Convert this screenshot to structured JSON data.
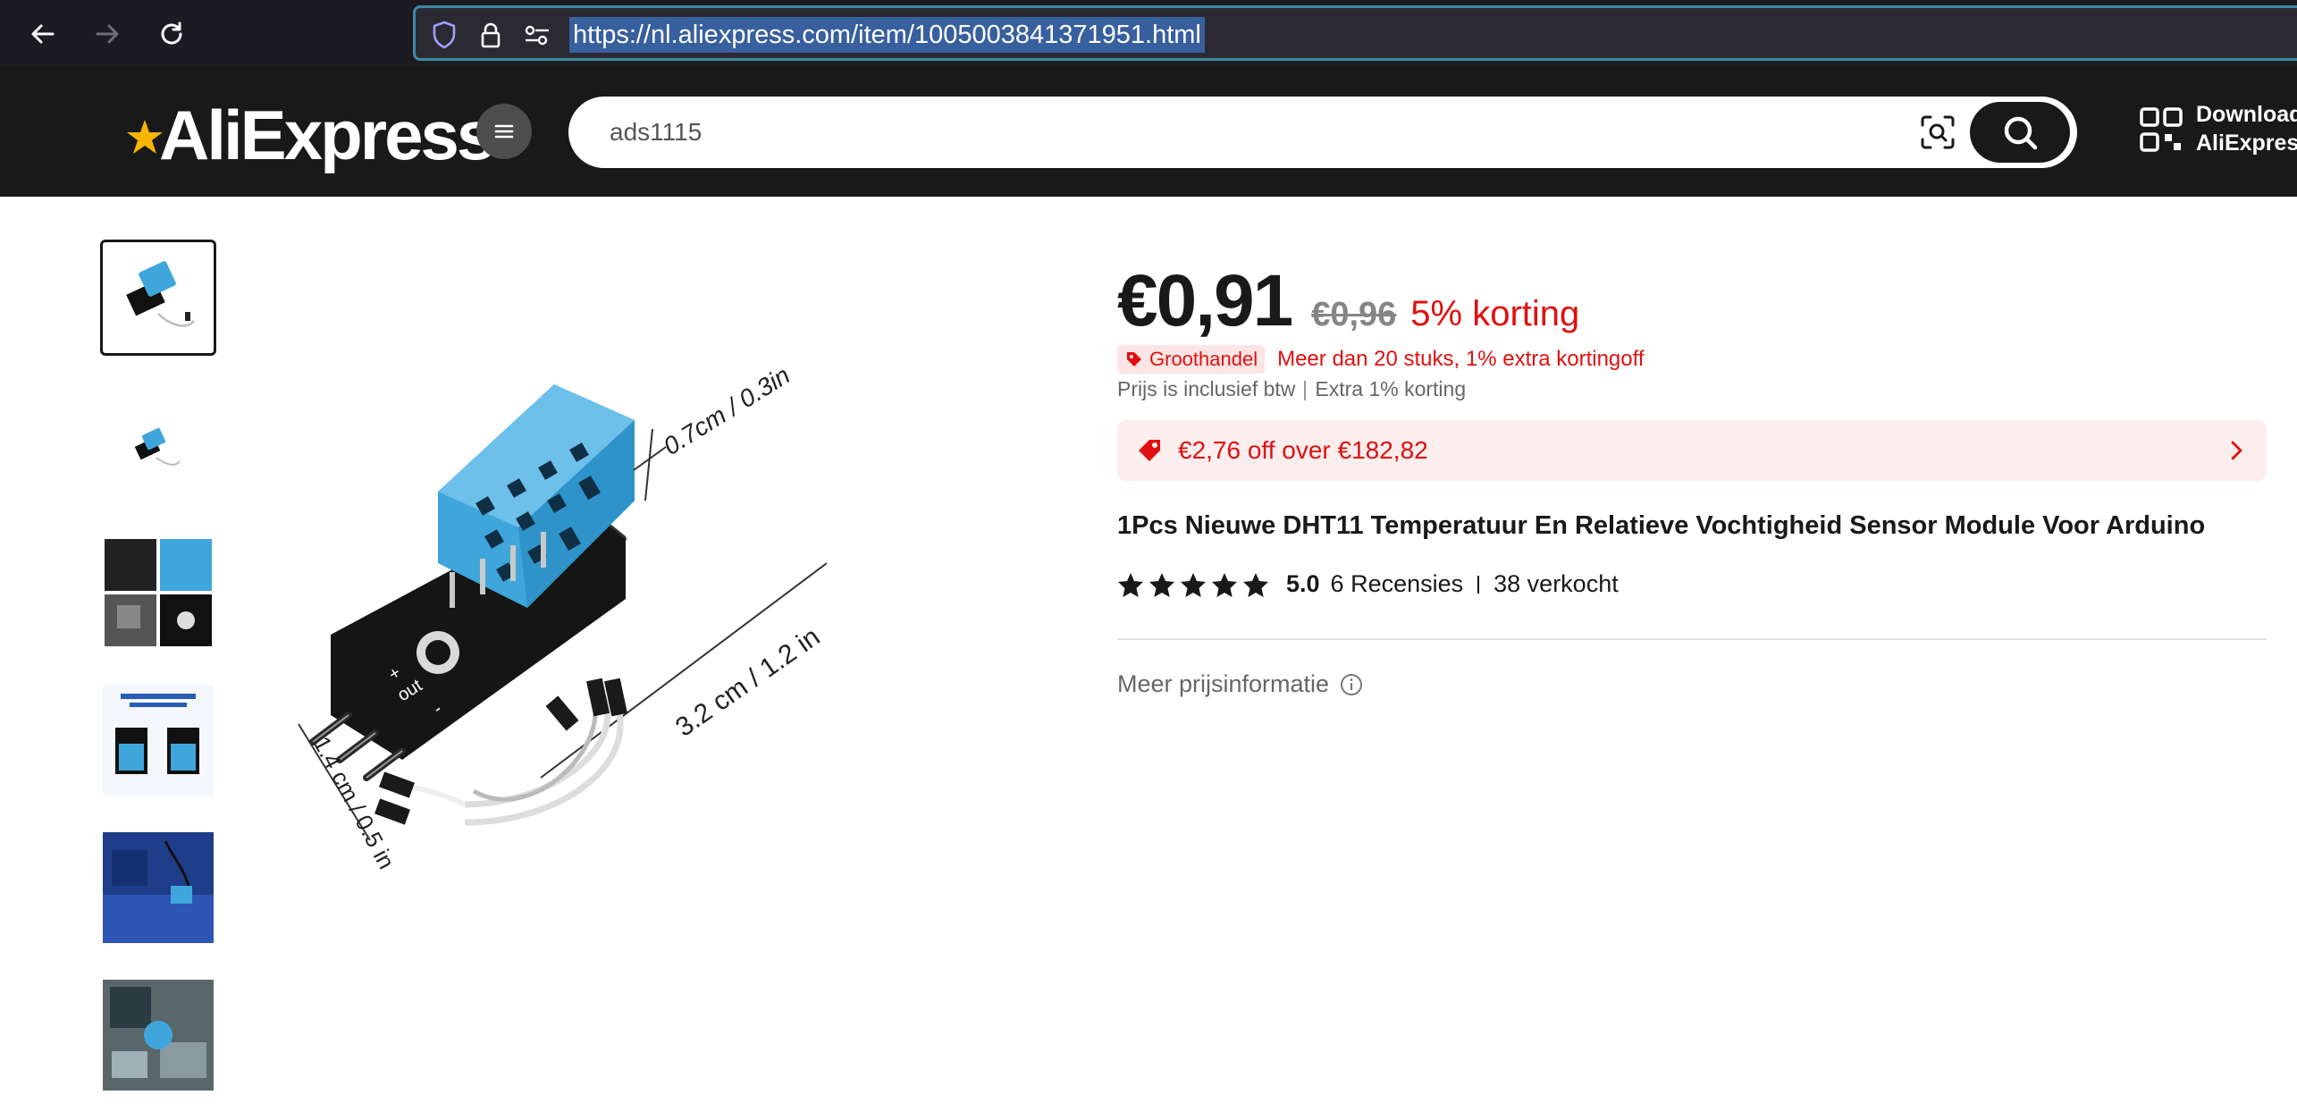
{
  "browser": {
    "url": "https://nl.aliexpress.com/item/1005003841371951.html"
  },
  "header": {
    "logo_text": "AliExpress",
    "search_value": "ads1115",
    "download_line1": "Download",
    "download_line2": "AliExpress"
  },
  "product": {
    "price": "€0,91",
    "old_price": "€0,96",
    "discount": "5% korting",
    "wholesale_badge": "Groothandel",
    "wholesale_info": "Meer dan 20 stuks, 1% extra kortingoff",
    "vat_text": "Prijs is inclusief btw",
    "extra_discount": "Extra 1% korting",
    "coupon_text": "€2,76 off over €182,82",
    "title": "1Pcs Nieuwe DHT11 Temperatuur En Relatieve Vochtigheid Sensor Module Voor Arduino",
    "rating": "5.0",
    "rating_stars": 5,
    "reviews": "6 Recensies",
    "sold": "38 verkocht",
    "more_price_info": "Meer prijsinformatie"
  },
  "image_labels": {
    "height_dim": "0.7cm / 0.3in",
    "length_dim": "3.2 cm / 1.2 in",
    "width_dim": "1.4 cm / 0.5 in",
    "pin_plus": "+",
    "pin_out": "out",
    "pin_minus": "-"
  },
  "colors": {
    "brand_dark": "#191919",
    "sale_red": "#e01010",
    "sensor_blue": "#3fa6dc",
    "url_highlight": "#385f9e"
  }
}
